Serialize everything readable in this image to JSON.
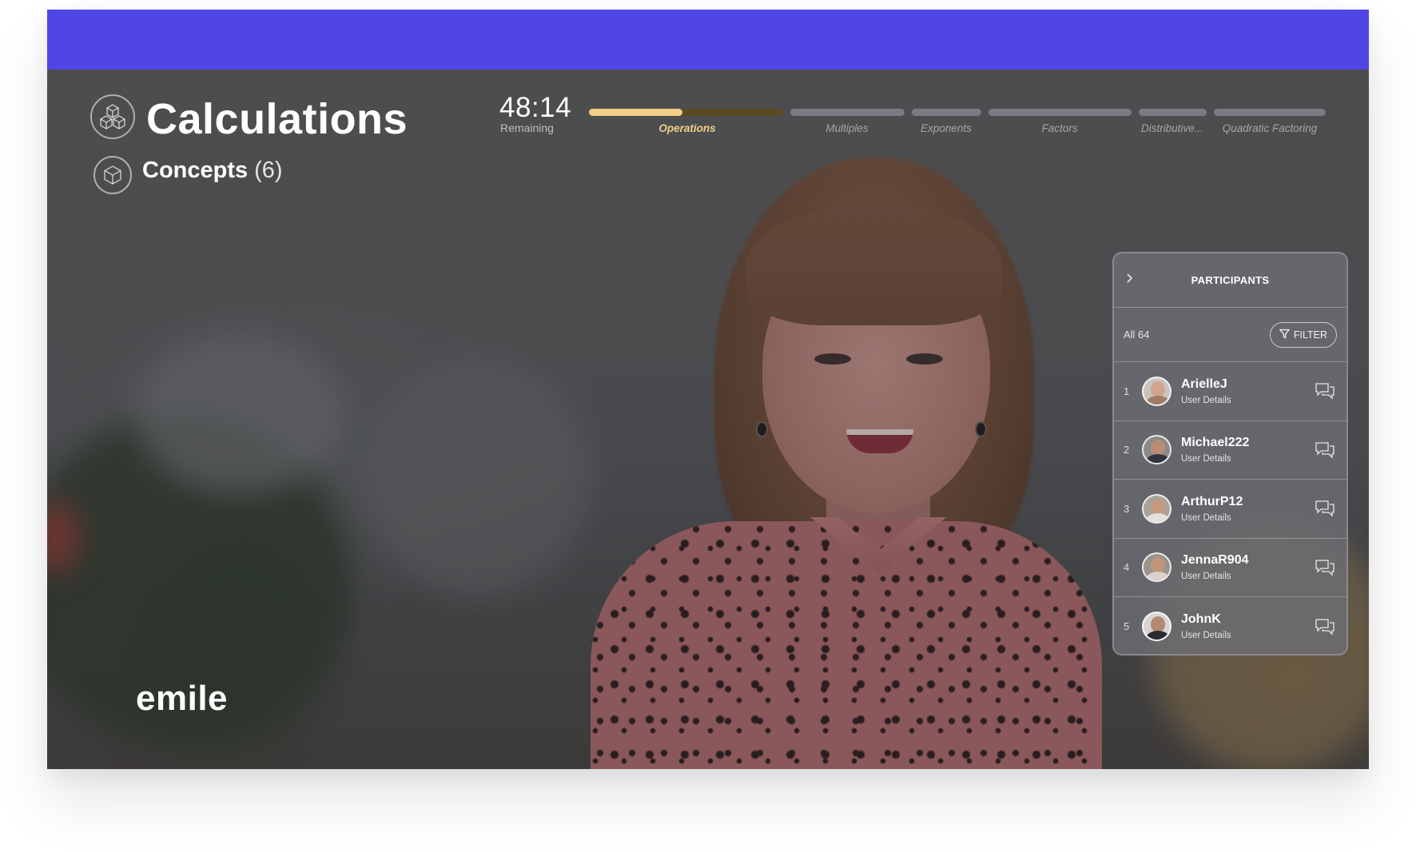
{
  "app": {
    "title": "Calculations",
    "concepts_label": "Concepts",
    "concepts_count": "(6)",
    "brand": "emile"
  },
  "timer": {
    "value": "48:14",
    "label": "Remaining"
  },
  "progress": {
    "active_index": 0,
    "active_fill_fraction": 0.48,
    "segments": [
      {
        "label": "Operations"
      },
      {
        "label": "Multiples"
      },
      {
        "label": "Exponents"
      },
      {
        "label": "Factors"
      },
      {
        "label": "Distributive..."
      },
      {
        "label": "Quadratic Factoring"
      }
    ]
  },
  "participants": {
    "title": "PARTICIPANTS",
    "all_label": "All 64",
    "filter_label": "FILTER",
    "items": [
      {
        "num": "1",
        "name": "ArielleJ",
        "details": "User Details"
      },
      {
        "num": "2",
        "name": "Michael222",
        "details": "User Details"
      },
      {
        "num": "3",
        "name": "ArthurP12",
        "details": "User Details"
      },
      {
        "num": "4",
        "name": "JennaR904",
        "details": "User Details"
      },
      {
        "num": "5",
        "name": "JohnK",
        "details": "User Details"
      }
    ]
  },
  "colors": {
    "top_bar": "#4f46e5",
    "progress_active": "#f2cf86",
    "progress_track": "#7c7b83"
  },
  "icons": [
    "cubes-icon",
    "cube-icon",
    "chevron-right-icon",
    "filter-icon",
    "chat-icon"
  ]
}
